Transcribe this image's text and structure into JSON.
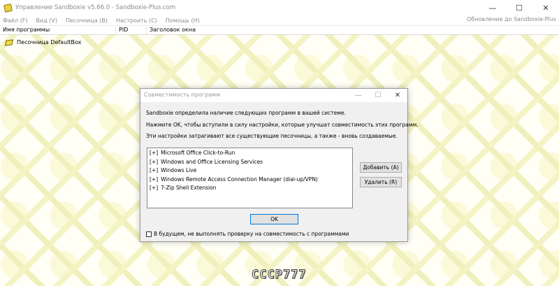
{
  "window": {
    "title": "Управление Sandboxie v5.66.0 - Sandboxie-Plus.com",
    "controls": {
      "minimize": "—",
      "maximize": "☐",
      "close": "✕"
    }
  },
  "menu": {
    "items": [
      "Файл (F)",
      "Вид (V)",
      "Песочница (B)",
      "Настроить (C)",
      "Помощь (H)"
    ],
    "update_link": "Обновление до Sandboxie-Plus"
  },
  "columns": {
    "program_name": "Имя программы",
    "pid": "PID",
    "window_title": "Заголовок окна"
  },
  "tree": {
    "sandbox_label": "Песочница DefaultBox"
  },
  "logo_text": "CCCP777",
  "dialog": {
    "title": "Совместимость программ",
    "line1": "Sandboxie определила наличие следующих программ в вашей системе.",
    "line2": "Нажмите OK, чтобы вступили в силу настройки, которые улучшат совместимость этих программ.",
    "line3": "Эти настройки затрагивают все существующие песочницы, а также - вновь создаваемые.",
    "programs": [
      {
        "marker": "[+]",
        "name": "Microsoft Office Click-to-Run"
      },
      {
        "marker": "[+]",
        "name": "Windows and Office Licensing Services"
      },
      {
        "marker": "[+]",
        "name": "Windows Live"
      },
      {
        "marker": "[+]",
        "name": "Windows Remote Access Connection Manager (dial-up/VPN)"
      },
      {
        "marker": "[+]",
        "name": "7-Zip Shell Extension"
      }
    ],
    "add_button": "Добавить (A)",
    "remove_button": "Удалить (R)",
    "ok_button": "OK",
    "checkbox_label": "В будущем, не выполнять проверку на совместимость с программами",
    "controls": {
      "minimize": "—",
      "maximize": "☐",
      "close": "✕"
    }
  },
  "colors": {
    "accent": "#0078d7",
    "sandbox_icon": "#f1df3c"
  }
}
